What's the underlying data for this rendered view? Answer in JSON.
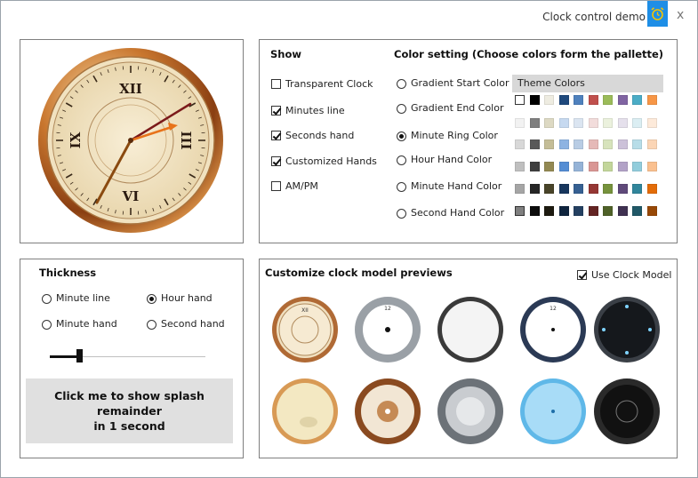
{
  "window": {
    "title": "Clock control demo",
    "close_label": "x"
  },
  "show": {
    "heading": "Show",
    "items": [
      {
        "label": "Transparent Clock",
        "checked": false
      },
      {
        "label": "Minutes line",
        "checked": true
      },
      {
        "label": "Seconds hand",
        "checked": true
      },
      {
        "label": "Customized Hands",
        "checked": true
      },
      {
        "label": "AM/PM",
        "checked": false
      }
    ]
  },
  "color_setting": {
    "heading": "Color setting (Choose colors form the pallette)",
    "options": [
      {
        "label": "Gradient Start Color",
        "selected": false
      },
      {
        "label": "Gradient End Color",
        "selected": false
      },
      {
        "label": "Minute Ring Color",
        "selected": true
      },
      {
        "label": "Hour Hand Color",
        "selected": false
      },
      {
        "label": "Minute Hand Color",
        "selected": false
      },
      {
        "label": "Second Hand Color",
        "selected": false
      }
    ],
    "theme_colors_label": "Theme Colors",
    "palette": [
      [
        "#ffffff",
        "#000000",
        "#eeece1",
        "#1f497d",
        "#4f81bd",
        "#c0504d",
        "#9bbb59",
        "#8064a2",
        "#4bacc6",
        "#f79646"
      ],
      [
        "#f2f2f2",
        "#7f7f7f",
        "#ddd9c3",
        "#c6d9f0",
        "#dbe5f1",
        "#f2dcdb",
        "#ebf1dd",
        "#e5e0ec",
        "#dbeef3",
        "#fdeada"
      ],
      [
        "#d8d8d8",
        "#595959",
        "#c4bd97",
        "#8db3e2",
        "#b8cce4",
        "#e5b9b7",
        "#d7e3bc",
        "#ccc1d9",
        "#b7dde8",
        "#fbd5b5"
      ],
      [
        "#bfbfbf",
        "#3f3f3f",
        "#938953",
        "#548dd4",
        "#95b3d7",
        "#d99694",
        "#c3d69b",
        "#b2a2c7",
        "#92cddc",
        "#fac08f"
      ],
      [
        "#a5a5a5",
        "#262626",
        "#494429",
        "#17365d",
        "#366092",
        "#953734",
        "#76923c",
        "#5f497a",
        "#31859b",
        "#e36c09"
      ],
      [
        "#7f7f7f",
        "#0c0c0c",
        "#1d1b10",
        "#0f243e",
        "#244061",
        "#632423",
        "#4f6128",
        "#3f3151",
        "#205867",
        "#974806"
      ]
    ]
  },
  "thickness": {
    "heading": "Thickness",
    "options": [
      {
        "label": "Minute line",
        "selected": false
      },
      {
        "label": "Hour hand",
        "selected": true
      },
      {
        "label": "Minute hand",
        "selected": false
      },
      {
        "label": "Second hand",
        "selected": false
      }
    ],
    "slider_value": 0.19,
    "splash_button_line1": "Click me to show  splash remainder",
    "splash_button_line2": "in 1 second"
  },
  "previews": {
    "heading": "Customize clock model previews",
    "use_model_label": "Use Clock Model",
    "use_model_checked": true,
    "models": [
      "classic-bronze",
      "silver-ring",
      "white-dark-ring",
      "white-blue-ring",
      "black-glow",
      "cream-rabbit",
      "copper",
      "grey-metal",
      "sky-blue",
      "black-dots"
    ]
  },
  "clock": {
    "numerals": [
      "XII",
      "III",
      "VI",
      "IX"
    ],
    "hour_hand_color": "#7b1a1a",
    "minute_hand_color": "#8a4a10",
    "second_hand_color": "#e8731a"
  }
}
